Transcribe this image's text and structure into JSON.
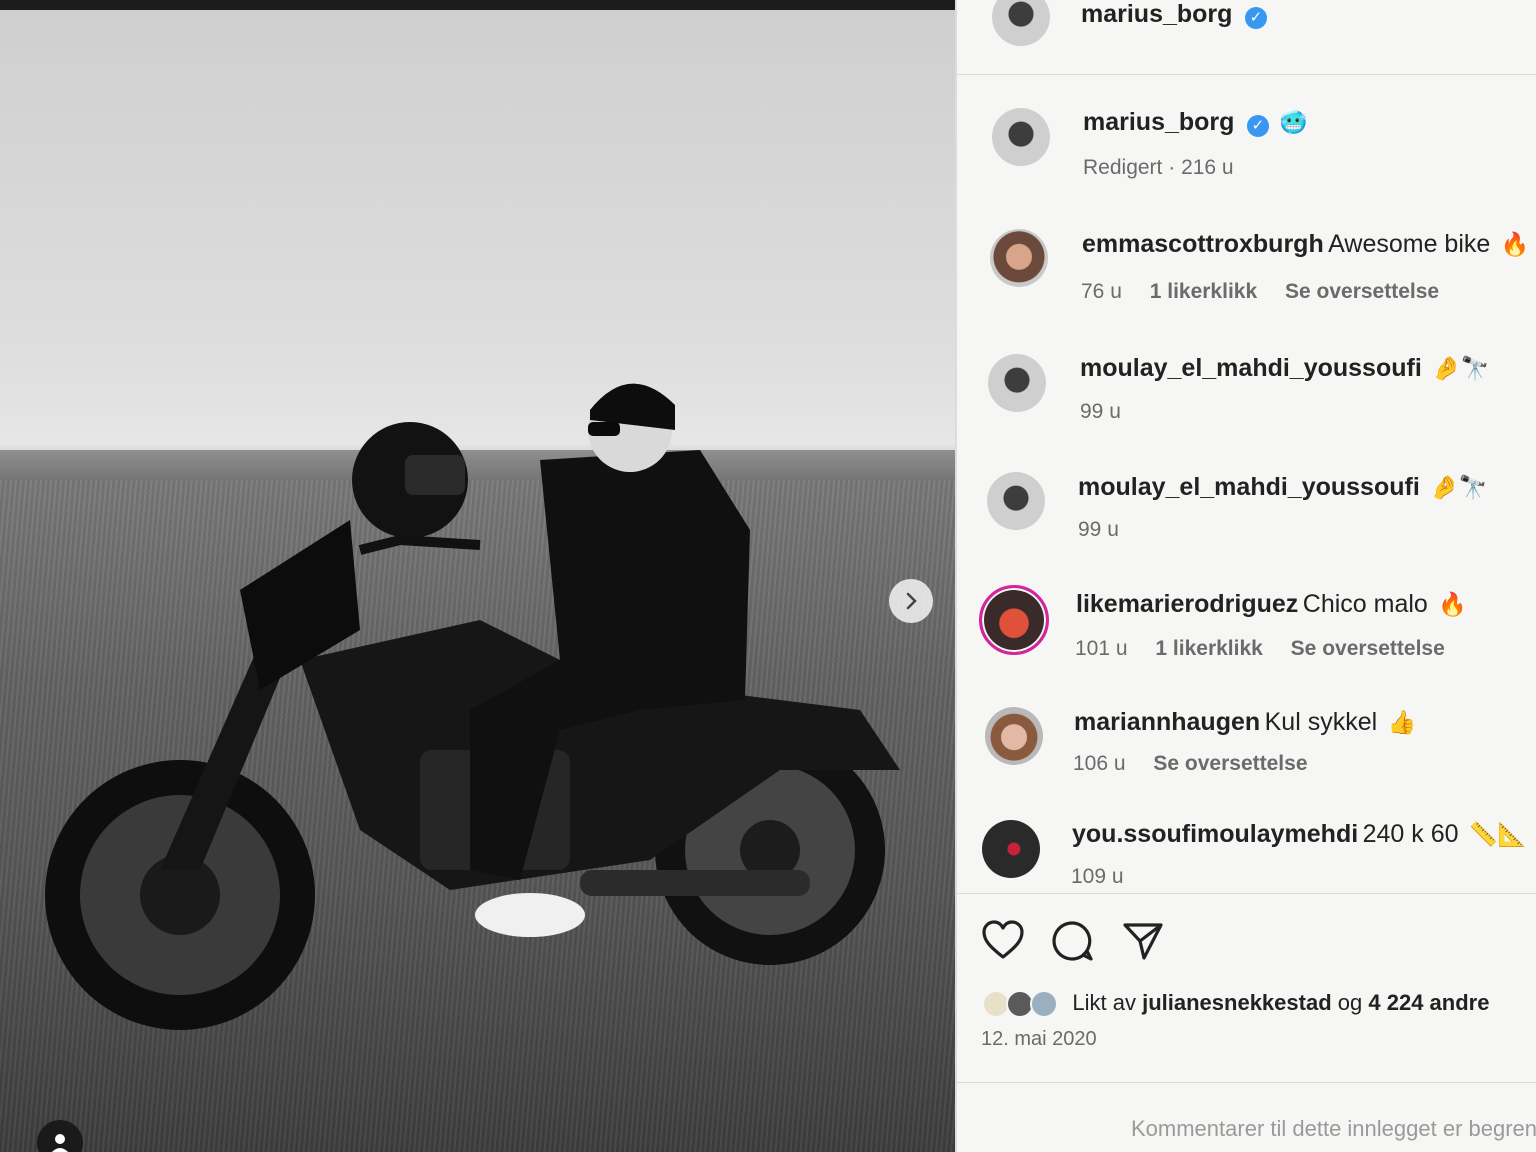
{
  "post": {
    "author": "marius_borg",
    "edited_label": "Redigert",
    "edited_time": "216 u",
    "caption_emoji": "🥶"
  },
  "comments": [
    {
      "user": "emmascottroxburgh",
      "text": "Awesome bike",
      "emoji": "🔥",
      "time": "76 u",
      "likes": "1 likerklikk",
      "translate": "Se oversettelse"
    },
    {
      "user": "moulay_el_mahdi_youssoufi",
      "text": "",
      "emoji": "🤌🔭",
      "time": "99 u",
      "likes": "",
      "translate": ""
    },
    {
      "user": "moulay_el_mahdi_youssoufi",
      "text": "",
      "emoji": "🤌🔭",
      "time": "99 u",
      "likes": "",
      "translate": ""
    },
    {
      "user": "likemarierodriguez",
      "text": "Chico malo",
      "emoji": "🔥",
      "time": "101 u",
      "likes": "1 likerklikk",
      "translate": "Se oversettelse"
    },
    {
      "user": "mariannhaugen",
      "text": "Kul sykkel",
      "emoji": "👍",
      "time": "106 u",
      "likes": "",
      "translate": "Se oversettelse"
    },
    {
      "user": "you.ssoufimoulaymehdi",
      "text": "240 k 60",
      "emoji": "📏📐",
      "time": "109 u",
      "likes": "",
      "translate": ""
    }
  ],
  "actions": {
    "like_icon": "heart-icon",
    "comment_icon": "comment-icon",
    "share_icon": "send-icon"
  },
  "likes": {
    "prefix": "Likt av",
    "user": "julianesnekkestad",
    "joiner": "og",
    "count": "4 224 andre"
  },
  "date": "12. mai 2020",
  "comments_disabled": "Kommentarer til dette innlegget er begrenset."
}
